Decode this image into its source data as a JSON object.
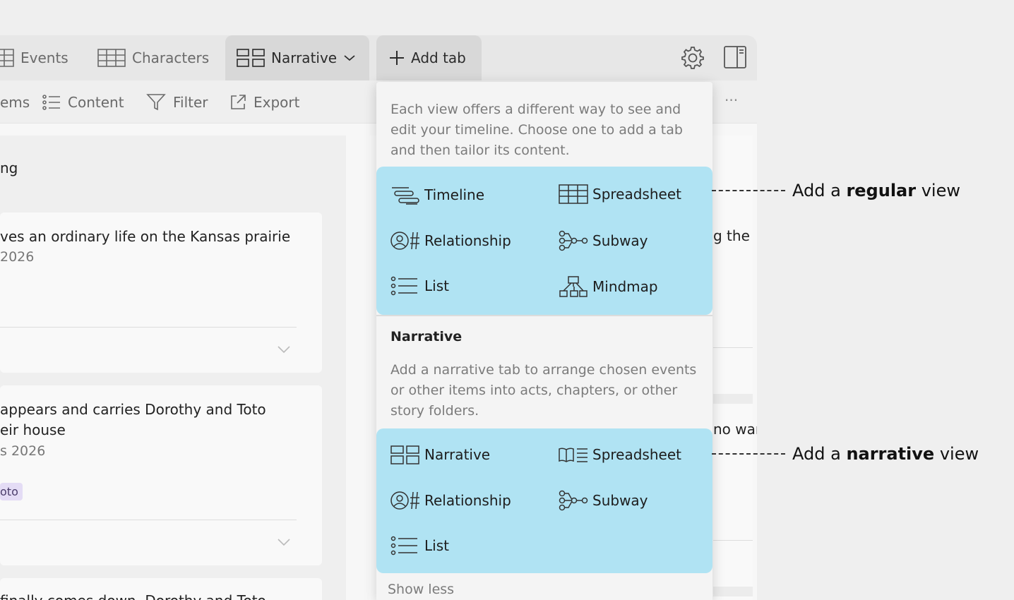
{
  "tabs": {
    "events": "Events",
    "characters": "Characters",
    "narrative": "Narrative",
    "add": "Add tab"
  },
  "toolbar": {
    "items_partial": "ems",
    "content": "Content",
    "filter": "Filter",
    "export": "Export",
    "more": "···"
  },
  "left": {
    "section_label": "ng",
    "card1": {
      "title": "ves an ordinary life on the Kansas prairie",
      "date": " 2026"
    },
    "card2": {
      "title_line1": "appears and carries Dorothy and Toto",
      "title_line2": "eir house",
      "date": "s 2026",
      "tag": "oto"
    },
    "card3": {
      "title": "finally comes down, Dorothy and Toto"
    }
  },
  "right": {
    "text1": "g the",
    "text2": "no war"
  },
  "popover": {
    "intro": "Each view offers a different way to see and edit your timeline. Choose one to add a tab and then tailor its content.",
    "regular": [
      {
        "label": "Timeline",
        "icon": "timeline-icon"
      },
      {
        "label": "Spreadsheet",
        "icon": "spreadsheet-icon"
      },
      {
        "label": "Relationship",
        "icon": "relationship-icon"
      },
      {
        "label": "Subway",
        "icon": "subway-icon"
      },
      {
        "label": "List",
        "icon": "list-icon"
      },
      {
        "label": "Mindmap",
        "icon": "mindmap-icon"
      }
    ],
    "narrative_heading": "Narrative",
    "narrative_desc": "Add a narrative tab to arrange chosen events or other items into acts, chapters, or other story folders.",
    "narrative": [
      {
        "label": "Narrative",
        "icon": "narrative-icon"
      },
      {
        "label": "Spreadsheet",
        "icon": "book-spreadsheet-icon"
      },
      {
        "label": "Relationship",
        "icon": "relationship-icon"
      },
      {
        "label": "Subway",
        "icon": "subway-icon"
      },
      {
        "label": "List",
        "icon": "list-icon"
      }
    ],
    "show_less": "Show less"
  },
  "annotations": {
    "regular": {
      "prefix": "Add a ",
      "bold": "regular",
      "suffix": " view"
    },
    "narrative": {
      "prefix": "Add a ",
      "bold": "narrative",
      "suffix": " view"
    }
  },
  "colors": {
    "highlight": "#b0e3f3",
    "tag": "#e4dcf5"
  }
}
